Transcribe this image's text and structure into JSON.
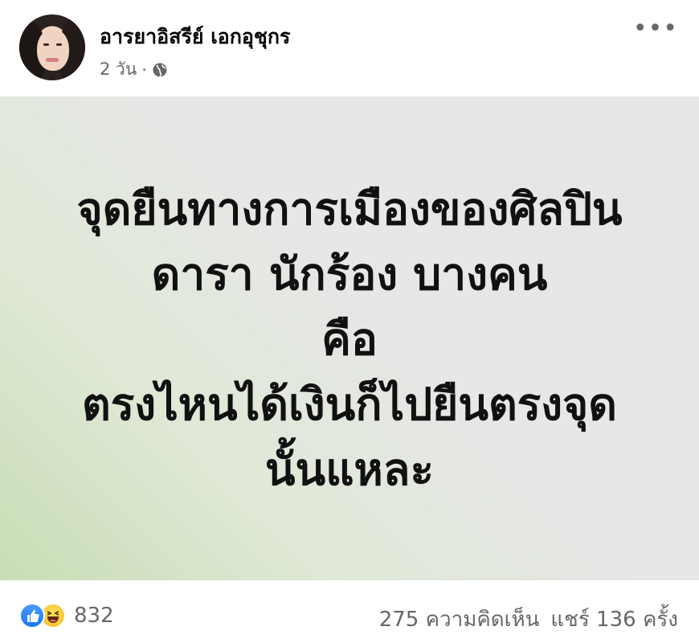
{
  "post": {
    "author": "อารยาอิสรีย์ เอกอุชุกร",
    "time": "2 วัน",
    "separator": "·",
    "privacy_icon": "globe-icon",
    "more_icon": "more-options-icon",
    "more_glyph": "•••"
  },
  "image_text": {
    "lines": [
      "จุดยืนทางการเมืองของศิลปิน",
      "ดารา นักร้อง  บางคน",
      "คือ",
      "ตรงไหนได้เงินก็ไปยืนตรงจุด",
      "นั้นแหละ"
    ]
  },
  "footer": {
    "reaction_icons": [
      "like-icon",
      "haha-icon"
    ],
    "reaction_count": "832",
    "comments": "275 ความคิดเห็น",
    "shares": "แชร์ 136 ครั้ง"
  },
  "colors": {
    "secondary_text": "#65676b",
    "like_blue": "#1877f2",
    "haha_yellow": "#f7b928"
  }
}
